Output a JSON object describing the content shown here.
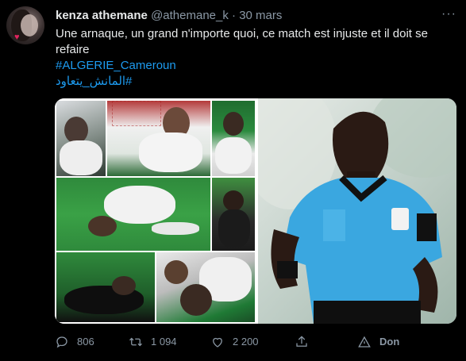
{
  "tweet": {
    "display_name": "kenza athemane",
    "handle": "@athemane_k",
    "separator": "·",
    "date": "30 mars",
    "more_label": "···",
    "text": "Une arnaque, un grand n'importe quoi, ce match est injuste et il doit se refaire",
    "hashtags": [
      "#ALGERIE_Cameroun",
      "#المانش_يتعاود"
    ]
  },
  "actions": {
    "reply_count": "806",
    "retweet_count": "1 094",
    "like_count": "2 200",
    "promote_label": "Don"
  },
  "colors": {
    "background": "#000000",
    "text": "#e7e9ea",
    "muted": "#8b98a5",
    "hashtag": "#1d9bf0",
    "referee_shirt": "#3aa7e0"
  },
  "icons": [
    "reply-icon",
    "retweet-icon",
    "like-icon",
    "share-icon",
    "promote-icon",
    "more-icon"
  ]
}
